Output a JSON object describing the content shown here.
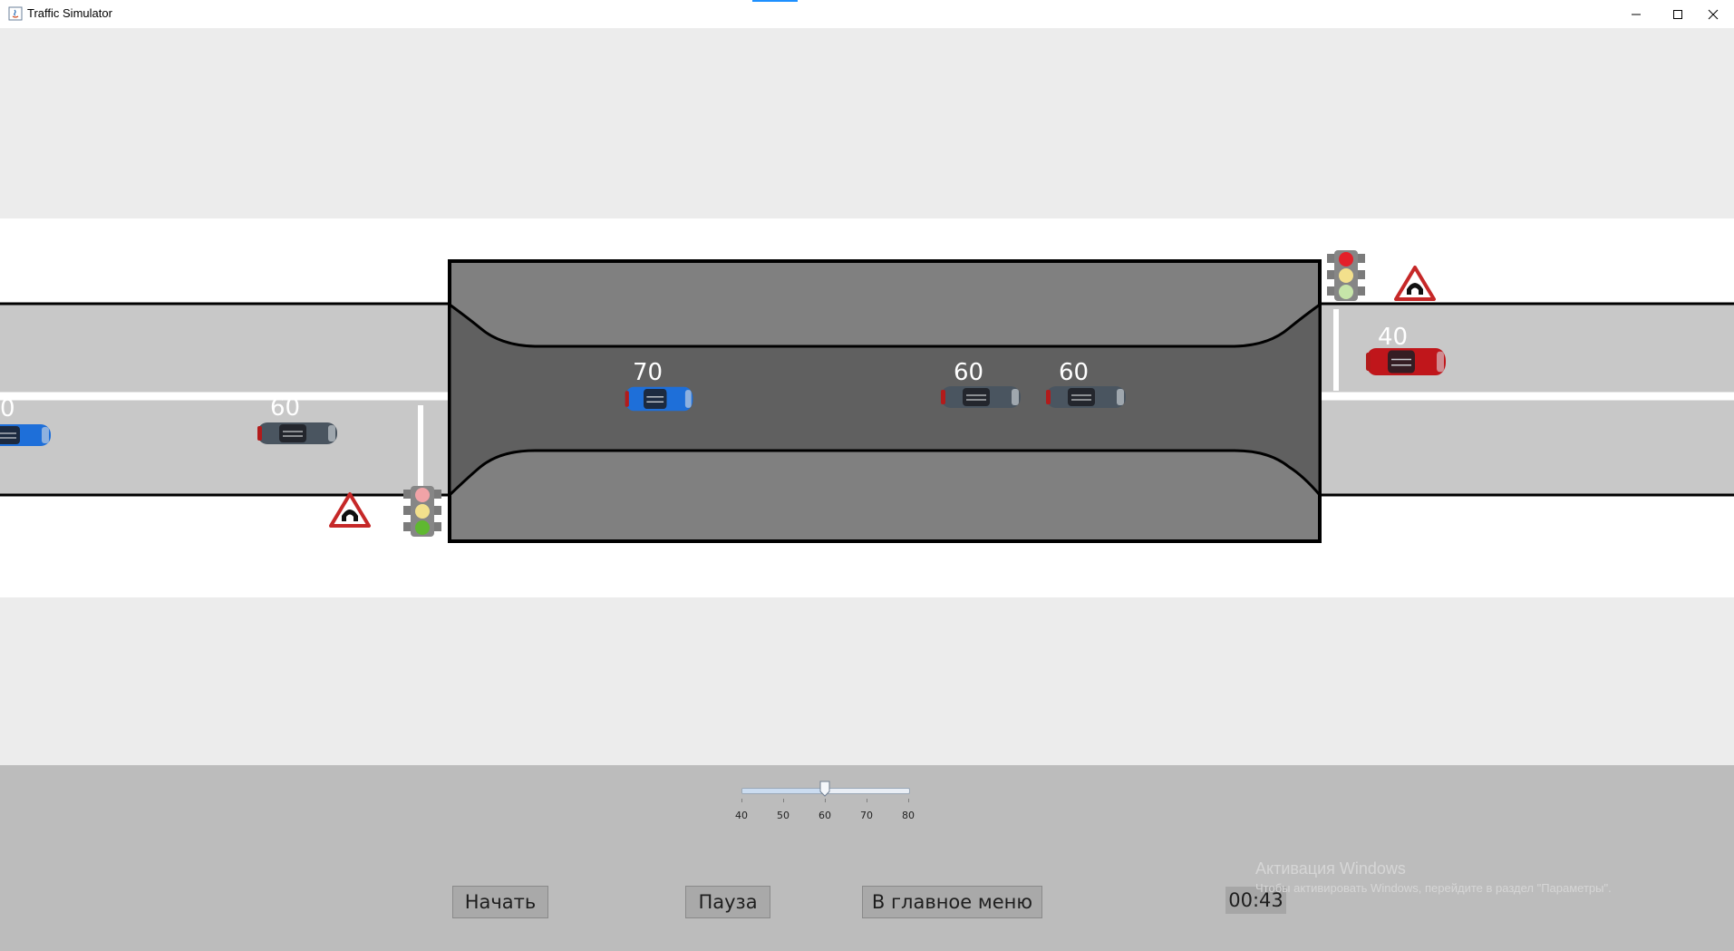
{
  "window": {
    "title": "Traffic Simulator",
    "minimize_icon": "minimize-icon",
    "maximize_icon": "maximize-icon",
    "close_icon": "close-icon"
  },
  "scene": {
    "cars": [
      {
        "speed_label": "0",
        "color": "#1e6fd9",
        "icon": "car-icon"
      },
      {
        "speed_label": "60",
        "color": "#4a5560",
        "icon": "car-icon"
      },
      {
        "speed_label": "70",
        "color": "#1e6fd9",
        "icon": "car-icon"
      },
      {
        "speed_label": "60",
        "color": "#4a5560",
        "icon": "car-icon"
      },
      {
        "speed_label": "60",
        "color": "#4a5560",
        "icon": "car-icon"
      },
      {
        "speed_label": "40",
        "color": "#c0161b",
        "icon": "car-icon"
      }
    ],
    "traffic_lights": [
      {
        "name": "traffic-light-right",
        "active": "red"
      },
      {
        "name": "traffic-light-left",
        "active": "green"
      }
    ],
    "signs": [
      "tunnel-warning-sign-icon",
      "tunnel-warning-sign-icon"
    ]
  },
  "controls": {
    "speed_slider": {
      "min": 40,
      "max": 80,
      "value": 60,
      "ticks": [
        "40",
        "50",
        "60",
        "70",
        "80"
      ]
    },
    "start_label": "Начать",
    "pause_label": "Пауза",
    "menu_label": "В главное меню",
    "timer": "00:43"
  },
  "watermark": {
    "title": "Активация Windows",
    "subtitle": "Чтобы активировать Windows, перейдите в раздел \"Параметры\"."
  },
  "colors": {
    "road": "#c8c8c8",
    "tunnel_outer": "#808080",
    "tunnel_inner": "#606060",
    "panel": "#bcbcbc"
  }
}
